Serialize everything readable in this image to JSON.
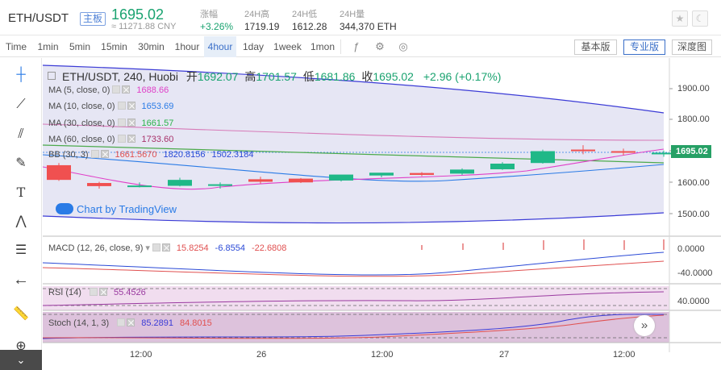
{
  "header": {
    "pair": "ETH/USDT",
    "badge": "主板",
    "price": "1695.02",
    "cny": "≈ 11271.88 CNY",
    "stats": [
      {
        "label": "涨幅",
        "value": "+3.26%"
      },
      {
        "label": "24H高",
        "value": "1719.19"
      },
      {
        "label": "24H低",
        "value": "1612.28"
      },
      {
        "label": "24H量",
        "value": "344,370 ETH"
      }
    ]
  },
  "toolbar": {
    "timeframes": [
      "Time",
      "1min",
      "5min",
      "15min",
      "30min",
      "1hour",
      "4hour",
      "1day",
      "1week",
      "1mon"
    ],
    "active_timeframe": "4hour",
    "views": [
      "基本版",
      "专业版",
      "深度图"
    ],
    "active_view": "专业版",
    "icons": [
      "indicators-icon",
      "settings-icon",
      "screenshot-icon"
    ]
  },
  "left_tools": [
    "crosshair-icon",
    "trend-line-icon",
    "fib-icon",
    "brush-icon",
    "text-icon",
    "pattern-icon",
    "measure-icon",
    "back-arrow-icon",
    "ruler-icon",
    "zoom-in-icon"
  ],
  "legend": {
    "ohlc_title": "ETH/USDT, 240, Huobi",
    "open_label": "开",
    "open": "1692.07",
    "high_label": "高",
    "high": "1701.57",
    "low_label": "低",
    "low": "1681.86",
    "close_label": "收",
    "close": "1695.02",
    "change": "+2.96 (+0.17%)",
    "ma": [
      {
        "label": "MA (5, close, 0)",
        "value": "1688.66",
        "color": "#e040c8"
      },
      {
        "label": "MA (10, close, 0)",
        "value": "1653.69",
        "color": "#2a7be6"
      },
      {
        "label": "MA (30, close, 0)",
        "value": "1661.57",
        "color": "#2bb34a"
      },
      {
        "label": "MA (60, close, 0)",
        "value": "1733.60",
        "color": "#a8326a"
      }
    ],
    "bb": {
      "label": "BB (30, 3)",
      "v1": "1661.5670",
      "v2": "1820.8156",
      "v3": "1502.3184"
    },
    "watermark": "Chart by TradingView"
  },
  "price_axis": [
    "1900.00",
    "1800.00",
    "1700.00",
    "1600.00",
    "1500.00"
  ],
  "last_price_tag": "1695.02",
  "macd": {
    "label": "MACD (12, 26, close, 9)",
    "v1": "15.8254",
    "v2": "-6.8554",
    "v3": "-22.6808",
    "axis": [
      "0.0000",
      "-40.0000"
    ]
  },
  "rsi": {
    "label": "RSI (14)",
    "value": "55.4526",
    "axis": [
      "40.0000"
    ]
  },
  "stoch": {
    "label": "Stoch (14, 1, 3)",
    "v1": "85.2891",
    "v2": "84.8015"
  },
  "time_axis": [
    "12:00",
    "26",
    "12:00",
    "27",
    "12:00"
  ],
  "chart_data": {
    "type": "candlestick",
    "candles": [
      {
        "o": 1655,
        "h": 1662,
        "l": 1605,
        "c": 1608
      },
      {
        "o": 1598,
        "h": 1602,
        "l": 1580,
        "c": 1588
      },
      {
        "o": 1588,
        "h": 1600,
        "l": 1584,
        "c": 1590
      },
      {
        "o": 1589,
        "h": 1615,
        "l": 1587,
        "c": 1608
      },
      {
        "o": 1592,
        "h": 1600,
        "l": 1580,
        "c": 1594
      },
      {
        "o": 1610,
        "h": 1618,
        "l": 1596,
        "c": 1602
      },
      {
        "o": 1612,
        "h": 1614,
        "l": 1598,
        "c": 1600
      },
      {
        "o": 1606,
        "h": 1620,
        "l": 1603,
        "c": 1625
      },
      {
        "o": 1622,
        "h": 1628,
        "l": 1616,
        "c": 1631
      },
      {
        "o": 1630,
        "h": 1633,
        "l": 1620,
        "c": 1624
      },
      {
        "o": 1628,
        "h": 1645,
        "l": 1624,
        "c": 1641
      },
      {
        "o": 1642,
        "h": 1665,
        "l": 1640,
        "c": 1660
      },
      {
        "o": 1662,
        "h": 1705,
        "l": 1660,
        "c": 1700
      },
      {
        "o": 1705,
        "h": 1719,
        "l": 1690,
        "c": 1700
      },
      {
        "o": 1700,
        "h": 1708,
        "l": 1686,
        "c": 1697
      },
      {
        "o": 1692,
        "h": 1702,
        "l": 1682,
        "c": 1695
      }
    ]
  }
}
